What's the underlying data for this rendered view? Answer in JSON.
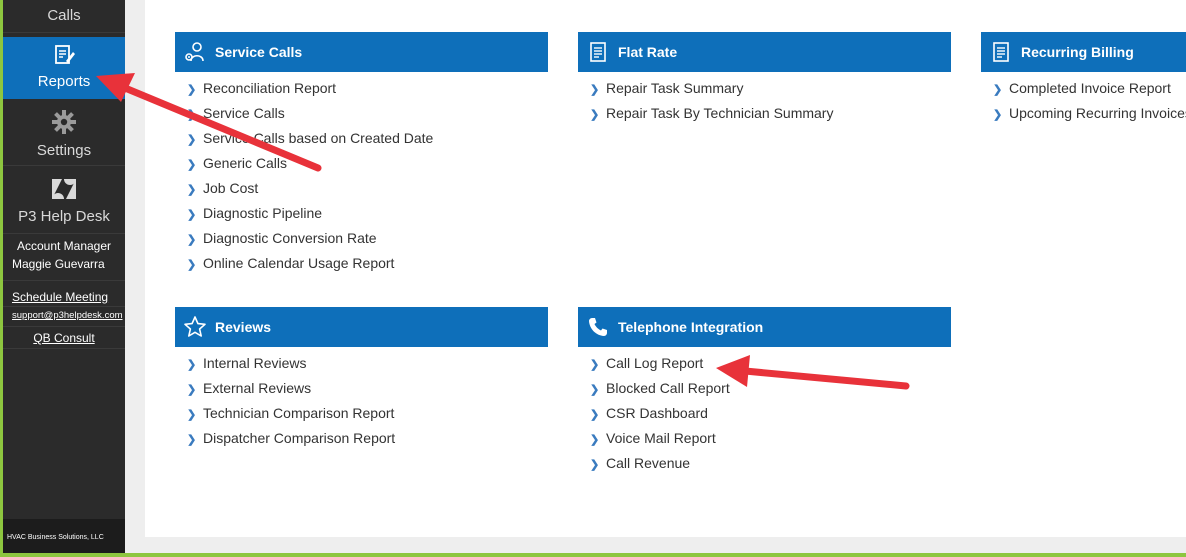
{
  "sidebar": {
    "calls_label": "Calls",
    "reports_label": "Reports",
    "settings_label": "Settings",
    "helpdesk_label": "P3 Help Desk",
    "account_manager_title": "Account Manager",
    "account_manager_name": "Maggie Guevarra",
    "schedule_meeting": "Schedule Meeting",
    "support_email": "support@p3helpdesk.com",
    "qb_consult": "QB Consult",
    "footer": "HVAC Business Solutions, LLC",
    "active_color": "#0e6fba",
    "accent_color": "#8dc63f"
  },
  "cards": {
    "service_calls": {
      "title": "Service Calls",
      "icon": "service-tech-icon",
      "items": [
        "Reconciliation Report",
        "Service Calls",
        "Service Calls based on Created Date",
        "Generic Calls",
        "Job Cost",
        "Diagnostic Pipeline",
        "Diagnostic Conversion Rate",
        "Online Calendar Usage Report"
      ]
    },
    "flat_rate": {
      "title": "Flat Rate",
      "icon": "document-icon",
      "items": [
        "Repair Task Summary",
        "Repair Task By Technician Summary"
      ]
    },
    "recurring_billing": {
      "title": "Recurring Billing",
      "icon": "document-icon",
      "items": [
        "Completed Invoice Report",
        "Upcoming Recurring Invoices"
      ]
    },
    "reviews": {
      "title": "Reviews",
      "icon": "star-icon",
      "items": [
        "Internal Reviews",
        "External Reviews",
        "Technician Comparison Report",
        "Dispatcher Comparison Report"
      ]
    },
    "telephone": {
      "title": "Telephone Integration",
      "icon": "phone-icon",
      "items": [
        "Call Log Report",
        "Blocked Call Report",
        "CSR Dashboard",
        "Voice Mail Report",
        "Call Revenue"
      ]
    }
  },
  "header_color": "#0e6fba",
  "annotation_color": "#e8323a"
}
